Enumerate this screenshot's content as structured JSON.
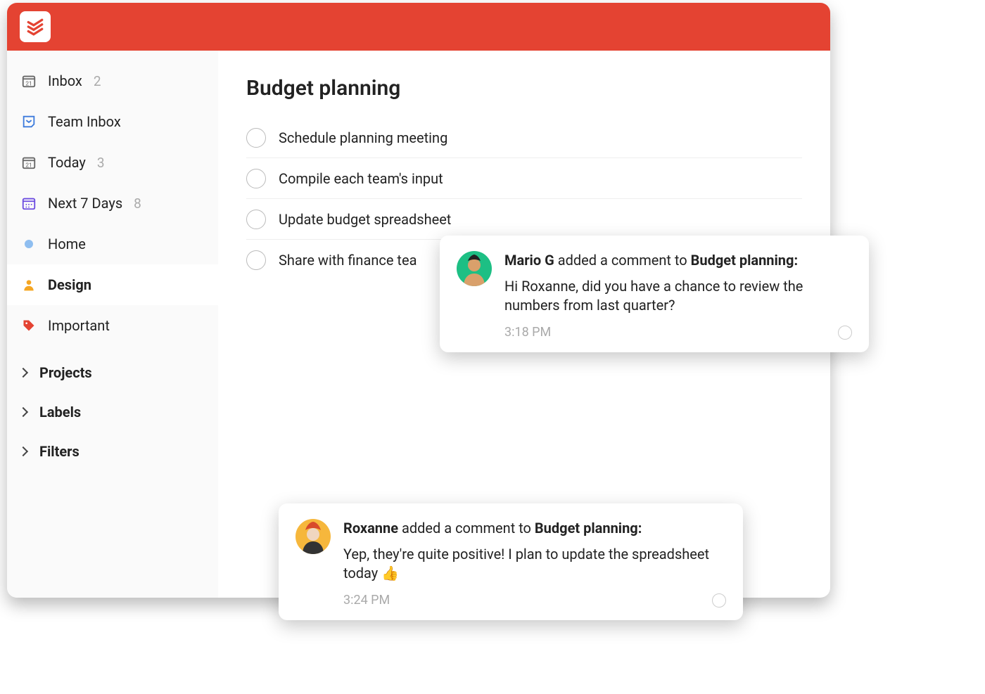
{
  "app": {
    "brand_color": "#e44332"
  },
  "sidebar": {
    "items": [
      {
        "label": "Inbox",
        "count": "2",
        "icon": "inbox-icon"
      },
      {
        "label": "Team Inbox",
        "count": "",
        "icon": "team-inbox-icon"
      },
      {
        "label": "Today",
        "count": "3",
        "icon": "today-icon"
      },
      {
        "label": "Next 7 Days",
        "count": "8",
        "icon": "next7-icon"
      },
      {
        "label": "Home",
        "count": "",
        "icon": "dot-icon"
      },
      {
        "label": "Design",
        "count": "",
        "icon": "person-icon"
      },
      {
        "label": "Important",
        "count": "",
        "icon": "tag-icon"
      }
    ],
    "sections": [
      {
        "label": "Projects"
      },
      {
        "label": "Labels"
      },
      {
        "label": "Filters"
      }
    ]
  },
  "main": {
    "title": "Budget planning",
    "tasks": [
      {
        "label": "Schedule planning meeting"
      },
      {
        "label": "Compile each team's input"
      },
      {
        "label": "Update budget spreadsheet"
      },
      {
        "label": "Share with finance tea"
      }
    ]
  },
  "notifications": [
    {
      "author": "Mario G",
      "verb": "added a comment to",
      "target": "Budget planning:",
      "body": "Hi Roxanne, did you have a chance to review the numbers from last quarter?",
      "time": "3:18 PM",
      "avatar_bg": "#1dbf84"
    },
    {
      "author": "Roxanne",
      "verb": "added a comment to",
      "target": "Budget planning:",
      "body": "Yep, they're quite positive! I plan to update the spreadsheet today 👍",
      "time": "3:24 PM",
      "avatar_bg": "#f6b73c"
    }
  ]
}
